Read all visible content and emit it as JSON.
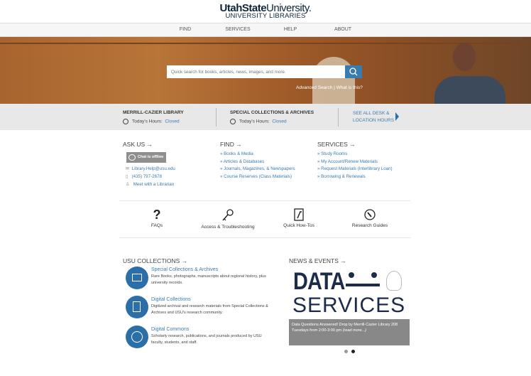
{
  "header": {
    "logo_bold": "UtahState",
    "logo_rest": "University.",
    "subtitle": "UNIVERSITY LIBRARIES"
  },
  "nav": [
    "FIND",
    "SERVICES",
    "HELP",
    "ABOUT"
  ],
  "search": {
    "placeholder": "Quick search for books, articles, news, images, and more.",
    "advanced": "Advanced Search",
    "what": "What is this?",
    "sep": " | "
  },
  "hours": {
    "lib1": {
      "name": "MERRILL-CAZIER LIBRARY",
      "label": "Today's Hours:",
      "status": "Closed"
    },
    "lib2": {
      "name": "SPECIAL COLLECTIONS & ARCHIVES",
      "label": "Today's Hours:",
      "status": "Closed"
    },
    "all1": "SEE ALL DESK &",
    "all2": "LOCATION HOURS"
  },
  "ask": {
    "title": "ASK US →",
    "chat": "Chat is offline",
    "email": "Library.Help@usu.edu",
    "phone": "(435) 797-2678",
    "meet": "Meet with a Librarian"
  },
  "find": {
    "title": "FIND →",
    "items": [
      "» Books & Media",
      "» Articles & Databases",
      "» Journals, Magazines, & Newspapers",
      "» Course Reserves (Class Materials)"
    ]
  },
  "services": {
    "title": "SERVICES →",
    "items": [
      "» Study Rooms",
      "» My Account/Renew Materials",
      "» Request Materials (Interlibrary Loan)",
      "» Borrowing & Renewals"
    ]
  },
  "quick": [
    "FAQs",
    "Access & Troubleshooting",
    "Quick How-Tos",
    "Research Guides"
  ],
  "collections": {
    "title": "USU COLLECTIONS →",
    "items": [
      {
        "title": "Special Collections & Archives",
        "desc": "Rare Books, photographs, manuscripts about regional history, plus university records."
      },
      {
        "title": "Digital Collections",
        "desc": "Digitized archival and research materials from Special Collections & Archives and USU's research community."
      },
      {
        "title": "Digital Commons",
        "desc": "Scholarly research, publications, and journals produced by USU faculty, students, and staff."
      }
    ]
  },
  "news": {
    "title": "NEWS & EVENTS →",
    "img1": "DATA",
    "img2": "SERVICES",
    "caption": "Data Questions Answered! Drop by Merrill-Cazier Library 208 Tuesdays from 2:00-3:00 pm",
    "more": "(read more...)"
  }
}
